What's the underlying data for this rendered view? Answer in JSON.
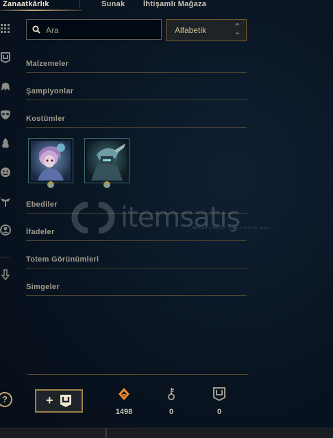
{
  "tabs": [
    {
      "label": "Zanaatkârlık",
      "active": true
    },
    {
      "label": "Sunak",
      "active": false
    },
    {
      "label": "İhtişamlı Mağaza",
      "active": false
    }
  ],
  "sidebar": {
    "icons": [
      "grid-icon",
      "chest-icon",
      "champion-helmet-icon",
      "skin-mask-icon",
      "ward-flame-icon",
      "emote-face-icon",
      "totem-icon",
      "profile-icon",
      "arrow-down-icon"
    ]
  },
  "search": {
    "placeholder": "Ara",
    "value": ""
  },
  "sort": {
    "selected": "Alfabetik"
  },
  "sections": [
    {
      "title": "Malzemeler"
    },
    {
      "title": "Şampiyonlar"
    },
    {
      "title": "Kostümler"
    },
    {
      "title": "Ebediler"
    },
    {
      "title": "İfadeler"
    },
    {
      "title": "Totem Görünümleri"
    },
    {
      "title": "Simgeler"
    }
  ],
  "skins": [
    {
      "name": "skin-shard-1",
      "accent": "#9a7fb8"
    },
    {
      "name": "skin-shard-2",
      "accent": "#4a7a7a"
    }
  ],
  "watermark": {
    "text": "itemsatış",
    "subtext": "HESAP • SKIN • ITEM • OYUN  .com"
  },
  "footer": {
    "help_label": "?",
    "add_label": "+",
    "currencies": [
      {
        "name": "orange-essence",
        "value": "1498",
        "color": "#f0892a"
      },
      {
        "name": "key-fragment",
        "value": "0",
        "color": "#a09b8c"
      },
      {
        "name": "chest",
        "value": "0",
        "color": "#a09b8c"
      }
    ]
  }
}
